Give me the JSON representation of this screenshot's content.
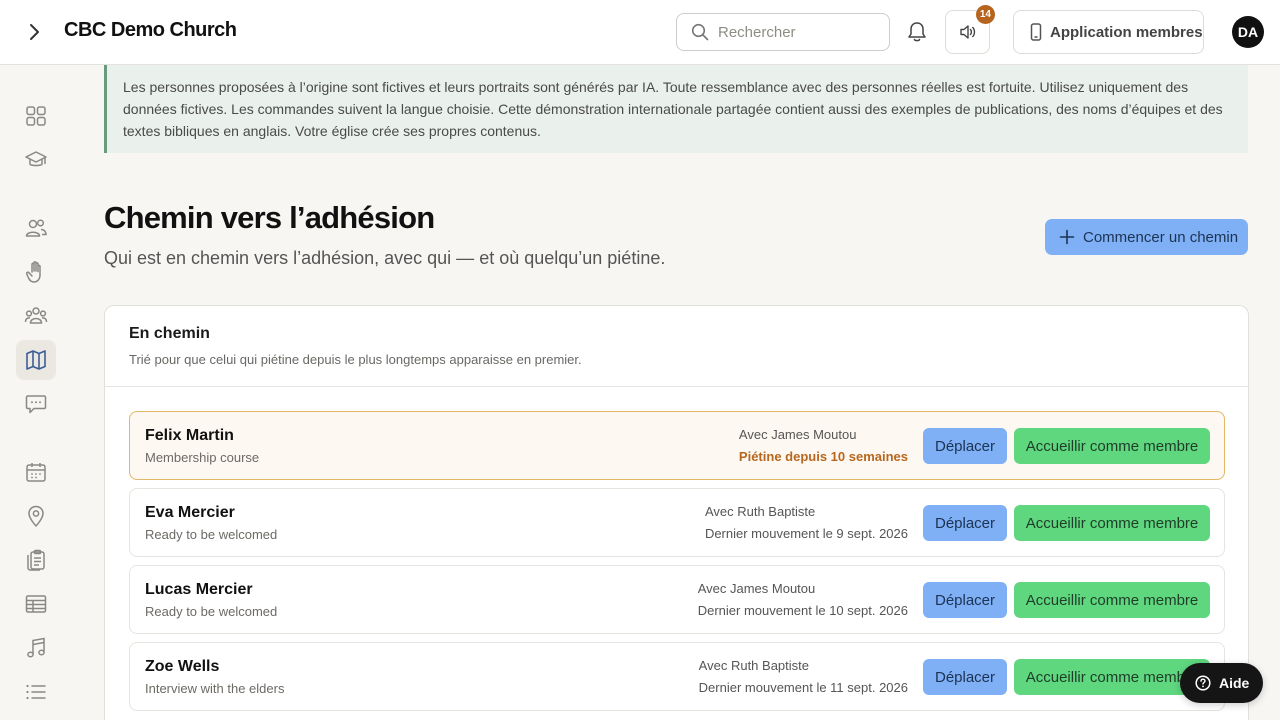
{
  "header": {
    "title": "CBC Demo Church",
    "search_placeholder": "Rechercher",
    "sound_badge": "14",
    "members_app_label": "Application membres",
    "avatar_initials": "DA"
  },
  "sidebar": {
    "items": [
      {
        "icon": "grid-icon"
      },
      {
        "icon": "graduation-cap-icon"
      },
      {
        "icon": "people-icon"
      },
      {
        "icon": "hand-icon"
      },
      {
        "icon": "groups-icon"
      },
      {
        "icon": "map-icon",
        "active": true
      },
      {
        "icon": "chat-icon"
      },
      {
        "icon": "calendar-icon"
      },
      {
        "icon": "location-pin-icon"
      },
      {
        "icon": "clipboard-icon"
      },
      {
        "icon": "table-icon"
      },
      {
        "icon": "music-icon"
      },
      {
        "icon": "list-icon"
      }
    ]
  },
  "notice": {
    "text": "Les personnes proposées à l’origine sont fictives et leurs portraits sont générés par IA. Toute ressemblance avec des personnes réelles est fortuite. Utilisez uniquement des données fictives. Les commandes suivent la langue choisie. Cette démonstration internationale partagée contient aussi des exemples de publications, des noms d’équipes et des textes bibliques en anglais. Votre église crée ses propres contenus."
  },
  "page": {
    "title": "Chemin vers l’adhésion",
    "subtitle": "Qui est en chemin vers l’adhésion, avec qui — et où quelqu’un piétine.",
    "start_button": "Commencer un chemin"
  },
  "card": {
    "title": "En chemin",
    "subtitle": "Trié pour que celui qui piétine depuis le plus longtemps apparaisse en premier.",
    "move_label": "Déplacer",
    "welcome_label": "Accueillir comme membre",
    "rows": [
      {
        "name": "Felix Martin",
        "stage": "Membership course",
        "with": "Avec James Moutou",
        "status": "Piétine depuis 10 semaines",
        "stalled": true
      },
      {
        "name": "Eva Mercier",
        "stage": "Ready to be welcomed",
        "with": "Avec Ruth Baptiste",
        "status": "Dernier mouvement le 9 sept. 2026",
        "stalled": false
      },
      {
        "name": "Lucas Mercier",
        "stage": "Ready to be welcomed",
        "with": "Avec James Moutou",
        "status": "Dernier mouvement le 10 sept. 2026",
        "stalled": false
      },
      {
        "name": "Zoe Wells",
        "stage": "Interview with the elders",
        "with": "Avec Ruth Baptiste",
        "status": "Dernier mouvement le 11 sept. 2026",
        "stalled": false
      }
    ]
  },
  "help": {
    "label": "Aide"
  },
  "colors": {
    "primary_button": "#7fb0f5",
    "welcome_button": "#5fd77f",
    "stalled_text": "#b8671f",
    "notice_border": "#6a9a7d"
  }
}
